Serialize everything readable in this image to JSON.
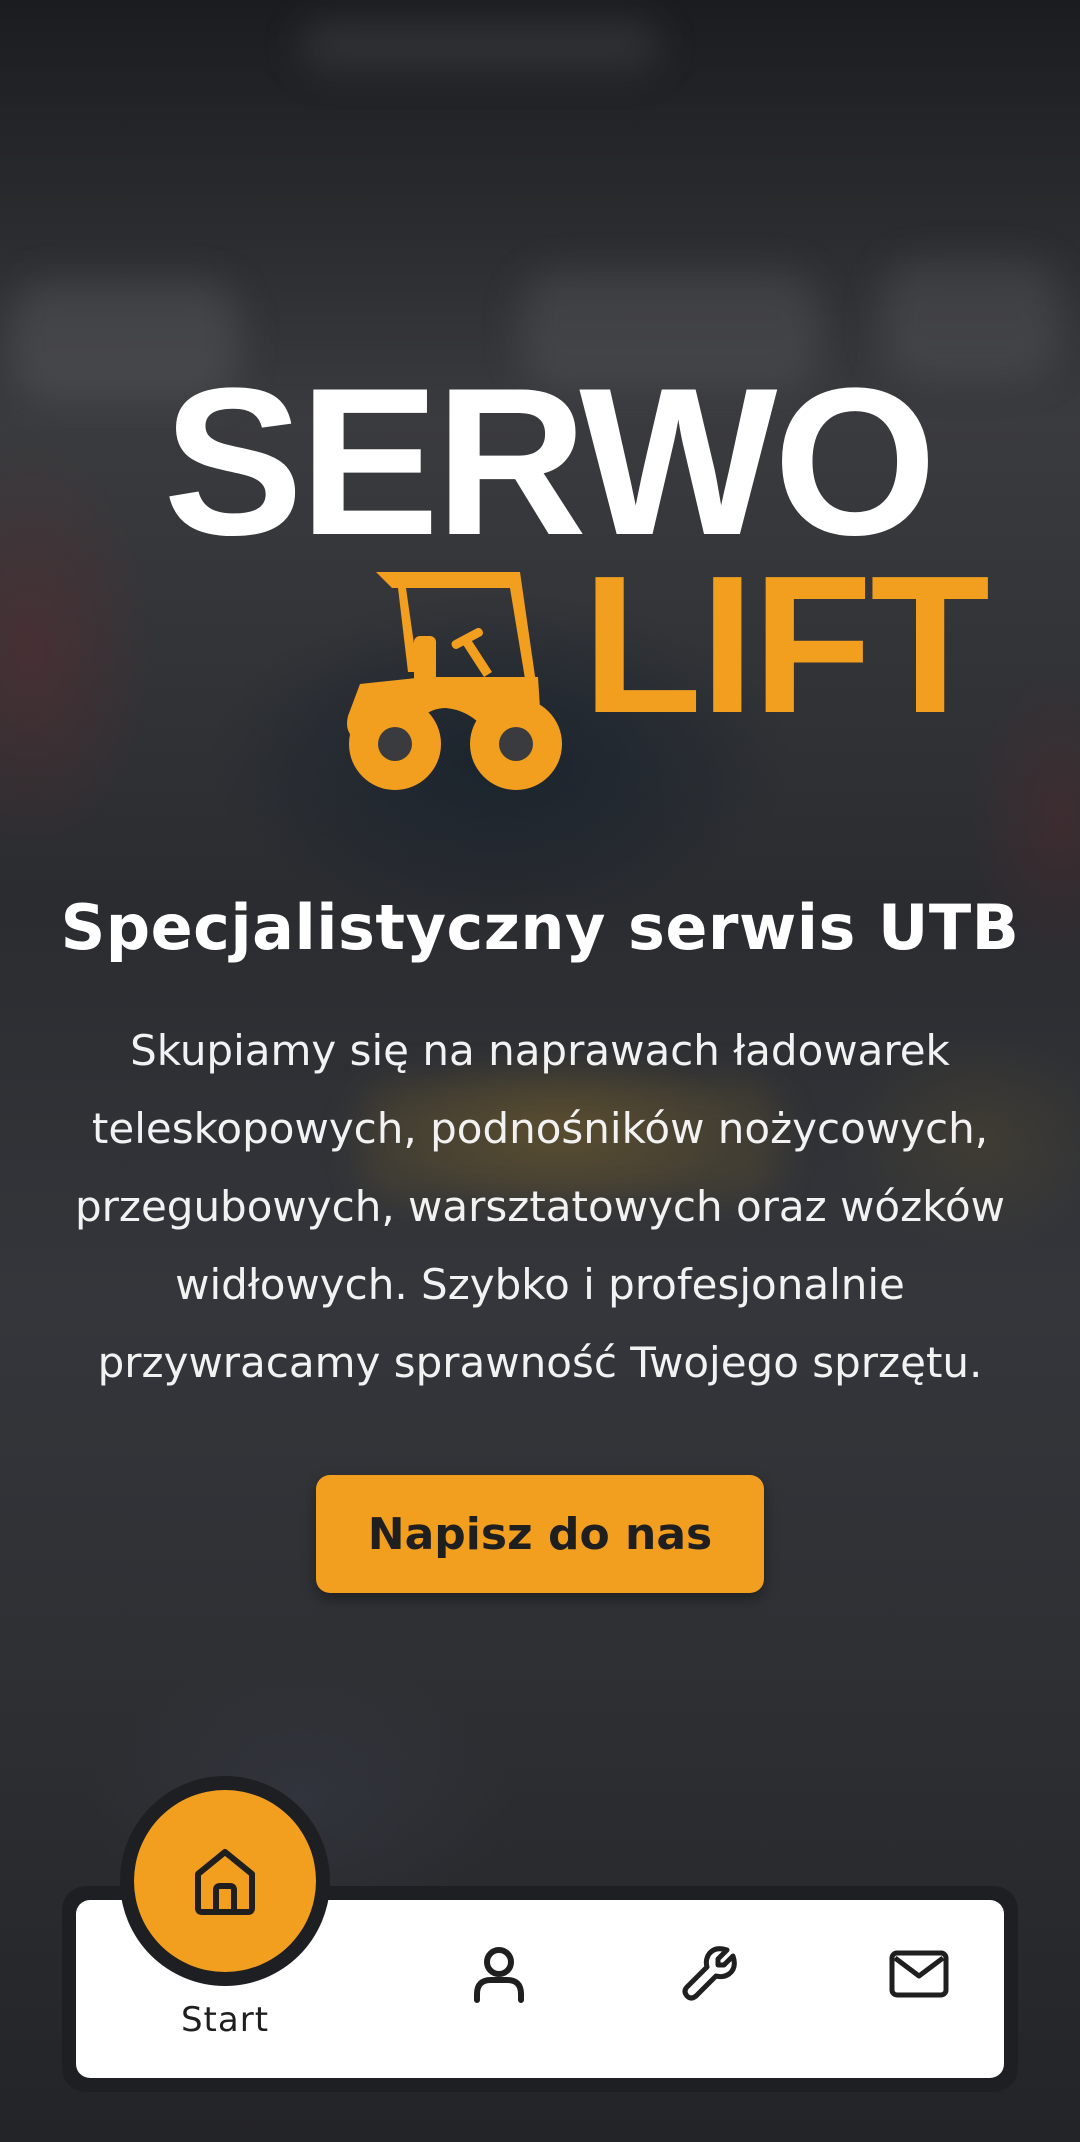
{
  "brand": {
    "logo_line1": "SERWO",
    "logo_line2": "LIFT",
    "white": "#ffffff",
    "accent": "#f29f1f"
  },
  "hero": {
    "headline": "Specjalistyczny serwis UTB",
    "description": "Skupiamy się na naprawach ładowarek teleskopowych, podnośników nożycowych, przegubowych, warsztatowych oraz wózków widłowych. Szybko i profesjonalnie przywracamy sprawność Twojego sprzętu.",
    "cta_label": "Napisz do nas"
  },
  "bottom_nav": {
    "items": [
      {
        "icon": "home-icon",
        "label": "Start",
        "active": true
      },
      {
        "icon": "user-icon",
        "label": ""
      },
      {
        "icon": "wrench-icon",
        "label": ""
      },
      {
        "icon": "mail-icon",
        "label": ""
      }
    ],
    "colors": {
      "bar": "#1e1f22",
      "panel": "#ffffff",
      "active": "#f29f1f"
    }
  }
}
